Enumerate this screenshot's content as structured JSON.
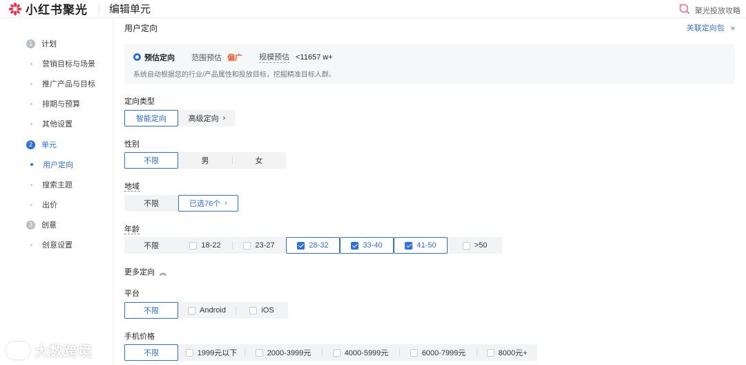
{
  "header": {
    "logo_text": "小红书聚光",
    "page_title": "编辑单元",
    "right_link": "聚光投放攻略"
  },
  "sidebar": {
    "steps": [
      {
        "num": "1",
        "label": "计划",
        "subs": [
          "营销目标与场景",
          "推广产品与目标",
          "排期与预算",
          "其他设置"
        ]
      },
      {
        "num": "2",
        "label": "单元",
        "subs": [
          "用户定向",
          "搜索主题",
          "出价"
        ]
      },
      {
        "num": "3",
        "label": "创意",
        "subs": [
          "创意设置"
        ]
      }
    ]
  },
  "main": {
    "section_title": "用户定向",
    "top_link": "关联定向包",
    "estimate": {
      "label": "预估定向",
      "range_label": "范围预估",
      "range_value": "偏广",
      "scale_label": "规模预估",
      "scale_value": "<11657 w+",
      "desc": "系统自动根据您的行业/产品属性和投放目标，挖掘精准目标人群。"
    },
    "targeting_type": {
      "label": "定向类型",
      "options": [
        "智能定向",
        "高级定向"
      ]
    },
    "gender": {
      "label": "性别",
      "options": [
        "不限",
        "男",
        "女"
      ]
    },
    "region": {
      "label": "地域",
      "options": [
        "不限",
        "已选76个"
      ]
    },
    "age": {
      "label": "年龄",
      "options": [
        "不限",
        "18-22",
        "23-27",
        "28-32",
        "33-40",
        "41-50",
        ">50"
      ]
    },
    "more_label": "更多定向",
    "platform": {
      "label": "平台",
      "options": [
        "不限",
        "Android",
        "iOS"
      ]
    },
    "price": {
      "label": "手机价格",
      "options": [
        "不限",
        "1999元以下",
        "2000-3999元",
        "4000-5999元",
        "6000-7999元",
        "8000元+"
      ]
    }
  },
  "watermark": "大数跨境",
  "colors": {
    "accent": "#2b6fe0",
    "warning": "#f05a28",
    "brand": "#ff2442"
  }
}
